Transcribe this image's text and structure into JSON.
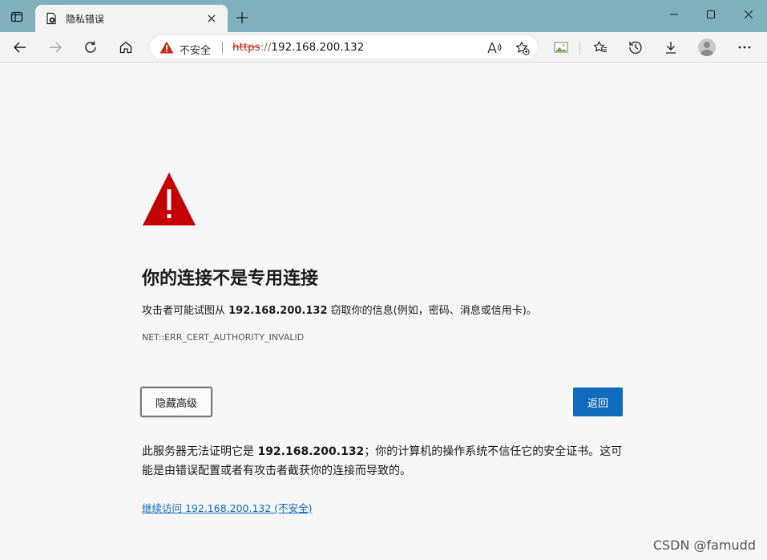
{
  "tab": {
    "title": "隐私错误"
  },
  "addressbar": {
    "security_label": "不安全",
    "url_scheme": "https",
    "url_slashes": "://",
    "url_host": "192.168.200.132"
  },
  "page": {
    "headline": "你的连接不是专用连接",
    "desc_prefix": "攻击者可能试图从 ",
    "desc_host": "192.168.200.132",
    "desc_suffix": " 窃取你的信息(例如，密码、消息或信用卡)。",
    "error_code": "NET::ERR_CERT_AUTHORITY_INVALID",
    "advanced_button": "隐藏高级",
    "back_button": "返回",
    "detail_prefix": "此服务器无法证明它是 ",
    "detail_host": "192.168.200.132",
    "detail_suffix": "；你的计算机的操作系统不信任它的安全证书。这可能是由错误配置或者有攻击者截获你的连接而导致的。",
    "proceed_link": "继续访问 192.168.200.132 (不安全)"
  },
  "watermark": "CSDN @famudd",
  "colors": {
    "tabstrip": "#7fb1bd",
    "warning_red": "#c40000",
    "accent_blue": "#0f6cbd"
  },
  "icons": {
    "tab_actions": "tab-actions-icon",
    "favicon": "error-page-icon",
    "close": "close-icon",
    "new_tab": "plus-icon",
    "back": "back-arrow-icon",
    "forward": "forward-arrow-icon",
    "refresh": "refresh-icon",
    "home": "home-icon",
    "read_aloud": "read-aloud-icon",
    "add_favorite": "add-favorite-icon",
    "image": "image-icon",
    "favorites": "favorites-icon",
    "history": "history-icon",
    "downloads": "download-icon",
    "profile": "profile-avatar",
    "more": "more-icon"
  }
}
